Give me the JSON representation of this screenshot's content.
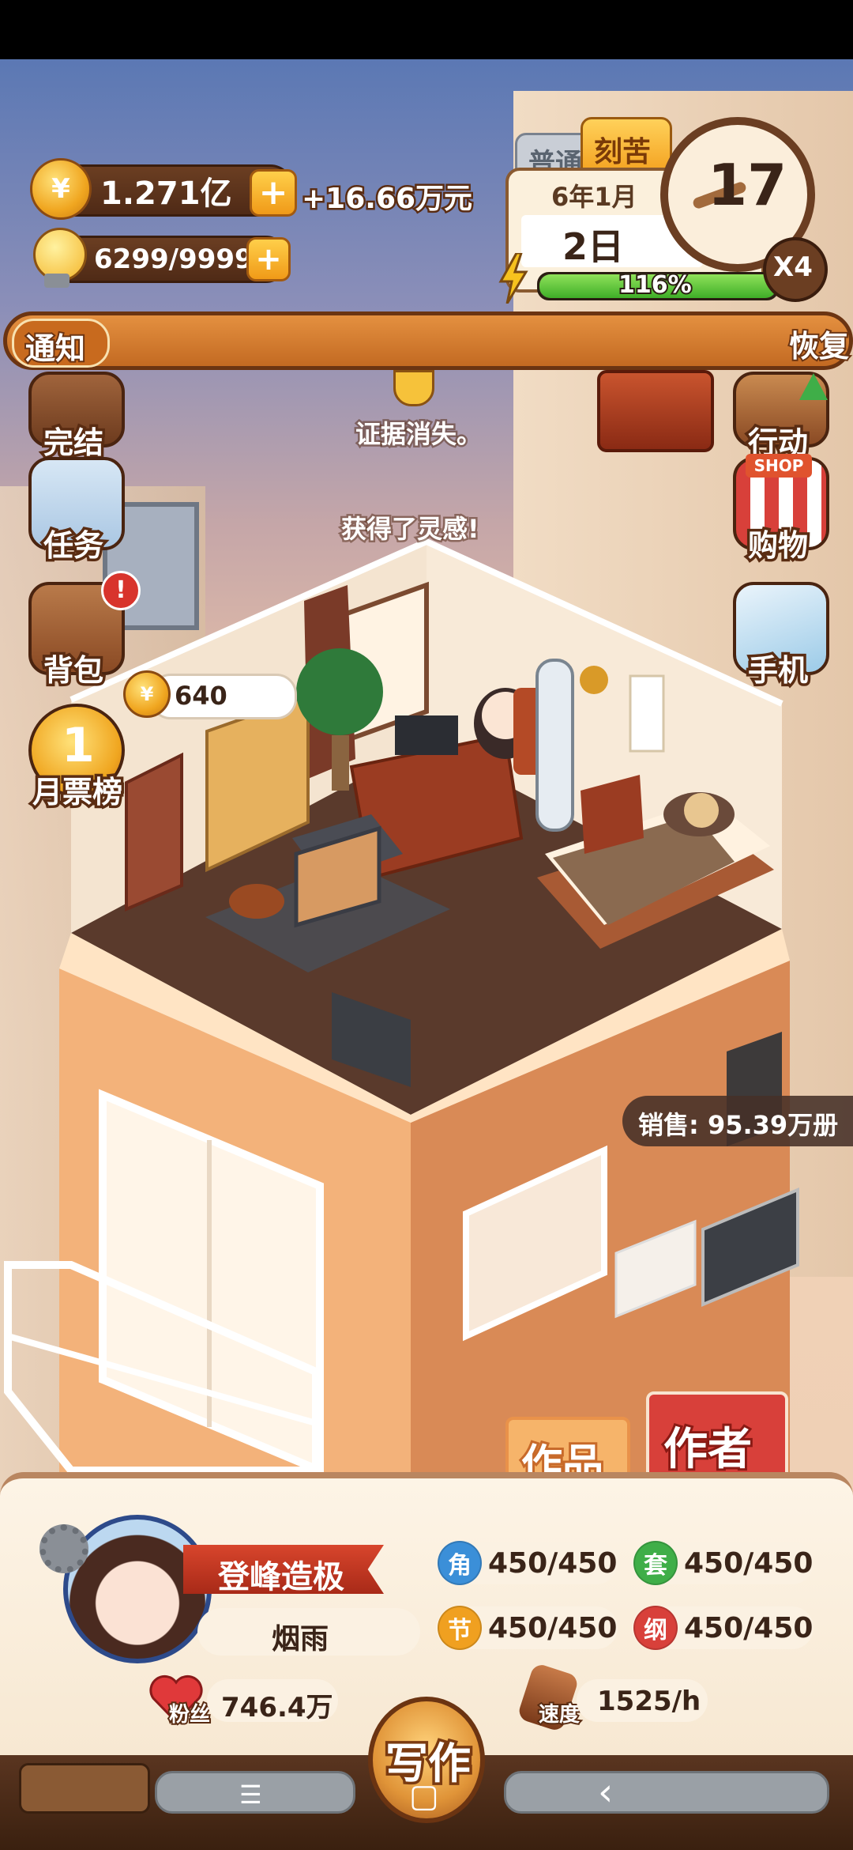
{
  "header": {
    "coins": "1.271亿",
    "coin_income": "+16.66万元",
    "inspiration": "6299/9999",
    "coin_symbol": "¥"
  },
  "calendar": {
    "mode_tab": "普通",
    "active_tab": "刻苦",
    "year_month": "6年1月",
    "day": "2日",
    "energy_percent": "116%",
    "energy_level": 1.0,
    "clock_value": "17",
    "speed_multiplier": "X4"
  },
  "notice": {
    "label": "通知",
    "text": "恢复"
  },
  "left_menu": [
    {
      "label": "完结"
    },
    {
      "label": "任务"
    },
    {
      "label": "背包",
      "badge": "!"
    },
    {
      "label": "月票榜",
      "medal": "1"
    }
  ],
  "right_menu": [
    {
      "label": "行动"
    },
    {
      "label": "购物",
      "sign": "SHOP"
    },
    {
      "label": "手机"
    }
  ],
  "floating": {
    "msg1": "证据消失。",
    "msg2": "获得了灵感!",
    "coin_bubble": "640",
    "sales": "销售: 95.39万册"
  },
  "tabs": {
    "works": "作品",
    "author": "作者"
  },
  "profile": {
    "title": "登峰造极",
    "name": "烟雨",
    "fans_label": "粉丝",
    "fans": "746.4万",
    "speed_label": "速度",
    "speed": "1525/h",
    "write_button": "写作"
  },
  "stats": [
    {
      "icon": "角",
      "value": "450/450",
      "color": "#3b8fd8"
    },
    {
      "icon": "套",
      "value": "450/450",
      "color": "#3fae48"
    },
    {
      "icon": "节",
      "value": "450/450",
      "color": "#f0a020"
    },
    {
      "icon": "纲",
      "value": "450/450",
      "color": "#d8403a"
    }
  ],
  "system_nav": {
    "menu": "☰",
    "home": "▢",
    "back": "‹"
  }
}
